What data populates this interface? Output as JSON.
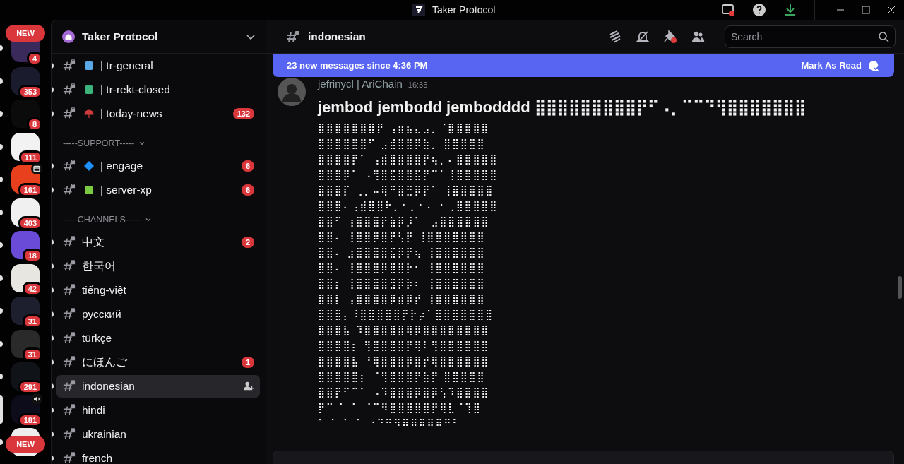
{
  "window": {
    "title": "Taker Protocol"
  },
  "servers": [
    {
      "kind": "plain",
      "badge": "4",
      "selected": false,
      "unread": true
    },
    {
      "kind": "plain",
      "badge": "353",
      "selected": false,
      "unread": true
    },
    {
      "kind": "plain",
      "badge": "8",
      "selected": false,
      "unread": true
    },
    {
      "kind": "plain",
      "badge": "111",
      "selected": false,
      "unread": true
    },
    {
      "kind": "event",
      "badge": "161",
      "selected": false,
      "unread": true
    },
    {
      "kind": "plain",
      "badge": "403",
      "selected": false,
      "unread": true
    },
    {
      "kind": "plain",
      "badge": "18",
      "selected": false,
      "unread": true
    },
    {
      "kind": "plain",
      "badge": "42",
      "selected": false,
      "unread": true
    },
    {
      "kind": "plain",
      "badge": "31",
      "selected": false,
      "unread": true
    },
    {
      "kind": "plain",
      "badge": "31",
      "selected": false,
      "unread": true
    },
    {
      "kind": "plain",
      "badge": "291",
      "selected": false,
      "unread": true
    },
    {
      "kind": "voice",
      "badge": "181",
      "selected": true,
      "unread": true
    },
    {
      "kind": "plain",
      "selected": false,
      "unread": true
    }
  ],
  "new_pills": [
    "NEW",
    "NEW"
  ],
  "sidebar": {
    "server_name": "Taker Protocol",
    "items": [
      {
        "kind": "emoji_channel",
        "name": "| tr-general",
        "unread": true,
        "selected": false
      },
      {
        "kind": "emoji_channel",
        "name": "| tr-rekt-closed",
        "unread": true,
        "selected": false
      },
      {
        "kind": "emoji_channel",
        "name": "| today-news",
        "unread": true,
        "selected": false,
        "badge": "132"
      },
      {
        "kind": "category",
        "name": "-----SUPPORT-----"
      },
      {
        "kind": "emoji_channel",
        "name": "| engage",
        "unread": true,
        "selected": false,
        "badge": "6"
      },
      {
        "kind": "emoji_channel",
        "name": "| server-xp",
        "unread": true,
        "selected": false,
        "badge": "6"
      },
      {
        "kind": "category",
        "name": "-----CHANNELS-----"
      },
      {
        "kind": "channel",
        "name": "中文",
        "unread": true,
        "selected": false,
        "badge": "2"
      },
      {
        "kind": "channel",
        "name": "한국어",
        "unread": true,
        "selected": false
      },
      {
        "kind": "channel",
        "name": "tiếng-việt",
        "unread": true,
        "selected": false
      },
      {
        "kind": "channel",
        "name": "русский",
        "unread": true,
        "selected": false
      },
      {
        "kind": "channel",
        "name": "türkçe",
        "unread": true,
        "selected": false
      },
      {
        "kind": "channel",
        "name": "にほんご",
        "unread": true,
        "selected": false,
        "badge": "1"
      },
      {
        "kind": "channel",
        "name": "indonesian",
        "unread": true,
        "selected": true
      },
      {
        "kind": "channel",
        "name": "hindi",
        "unread": true,
        "selected": false
      },
      {
        "kind": "channel",
        "name": "ukrainian",
        "unread": true,
        "selected": false
      },
      {
        "kind": "channel",
        "name": "french",
        "unread": true,
        "selected": false
      }
    ]
  },
  "channel_header": {
    "name": "indonesian",
    "search": {
      "placeholder": "Search"
    }
  },
  "banner": {
    "text": "23 new messages since 4:36 PM",
    "action": "Mark As Read"
  },
  "message": {
    "author": "jefrinycl | AriChain",
    "time": "16:35",
    "heading": "jembod jembodd jembodddd ⣿⣿⣿⣿⣿⣿⣿⣿⣿⡟⠋⠠⡀⠉⠉⠙⢻⣿⣿⣿⣿⣿⣿⣿",
    "lines": [
      "⣿⣿⣿⣿⣿⣿⣿⡟ ⢠⣶⣦⣄⣠⡀⠈⣿⣿⣿⣿⣿",
      "⣿⣿⣿⣿⣿⣿⠋ ⣠⣾⣿⣿⡿⣷⡀ ⣿⣿⣿⣿⣿",
      "⣿⣿⣿⣿⡟⠁ ⢠⣾⣿⣿⣿⣿⡟⢦⡀⠄⣿⣿⣿⣿⣿",
      "⣿⣿⣿⡿⠁ ⠠⢻⣿⣯⣿⣿⣯⡟⠉⠁⢸⣿⣿⣿⣿⣿",
      "⣿⣿⣿⡏ ⢀⡀⠤⢿⠛⣿⣛⡿⡟⠁ ⢸⣿⣿⣿⣿⣿",
      "⣿⣿⣿⠄⢠⣾⣿⣿⠗⡀⠂⡀⠂⠄ ⠂⢀⣿⣿⣿⣿⣿",
      "⣿⣿⠋ ⢰⣿⣿⣿⡟⣷⡿⡸⠁  ⣠⣿⣿⣿⣿⣿⣿",
      "⣿⣿⠄ ⢸⣿⣿⡿⣿⡟⢣⡟ ⢸⣿⣿⣿⣿⣿⣿⣿",
      "⣿⣿⠄ ⣰⣿⣿⣿⣿⣯⡿⡟⢦ ⢸⣿⣿⣿⣿⣿⣿",
      "⣿⣿⠄ ⢸⣿⣿⣿⡿⣿⣿⡗⠂ ⢸⣿⣿⣿⣿⣿⣿",
      "⣿⣿⡆ ⢸⣿⣿⣿⣿⣻⡿⡷⠆ ⢸⣿⣿⣿⣿⣿⣿",
      "⣿⣿⡇ ⢠⣿⣿⣿⣿⡿⣾⡿⡞ ⢸⣿⣿⣿⣿⣿⣿",
      "⣿⣿⣿⡄⠸⣿⣿⣿⣿⣿⡟⡗⡴⠁⣿⣿⣿⣿⣿⣿⣿",
      "⣿⣿⣿⣧ ⠹⣿⣿⣿⣿⣿⢿⡿⣿⣿⣿⣿⣿⣿⣿⣿",
      "⣿⣿⣿⣿⡆ ⢻⣿⣿⣿⣿⡟⢿⠇⢻⣿⣿⣿⣿⣿⣿",
      "⣿⣿⣿⣿⣧ ⠘⢿⣿⣿⣿⡿⣿⡞⢿⣿⣿⣿⣿⣿⣿",
      "⣿⣿⣿⣿⣿⡆ ⠈⢻⣿⣿⣿⡟⣷⡟ ⣿⣿⣿⣿⣿",
      "⣿⣿⡟⠋⠉⠁ ⠠⠹⣿⣿⣿⡿⣿⡿⢣⠹⣿⣿⣿⣿",
      "⡟⠉ ⠁ ⠁ ⠈⠉⠻⣿⣿⣿⣿⣿⡟⢿⣇⠈⢹⣿",
      "⠁ ⠁ ⠁ ⠁ ⠐⠙⠛⠻⠿⠿⠿⠿⠿⠛⠃"
    ]
  }
}
